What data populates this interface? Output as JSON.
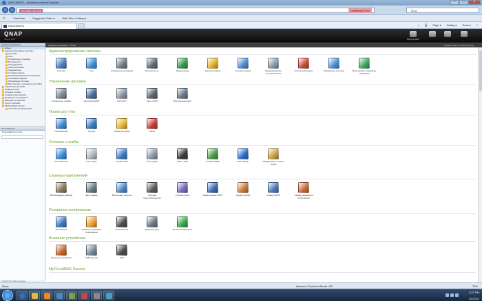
{
  "window": {
    "title": "NASC5B97D - Windows Internet Explorer"
  },
  "address": {
    "url": "192.168.100.155",
    "certificate": "Certificate Error"
  },
  "search": {
    "placeholder": "Bing"
  },
  "favorites": {
    "label": "Favorites",
    "items": [
      "Suggested Sites ▾",
      "Web Slice Gallery ▾"
    ]
  },
  "tab": {
    "label": "NASC5B97D"
  },
  "commands": [
    "Page ▾",
    "Safety ▾",
    "Tools ▾"
  ],
  "qnap": {
    "logo": "QNAP",
    "tagline": "Simply NAS",
    "header_icons": [
      "Вход на сайт",
      "",
      "",
      ""
    ]
  },
  "breadcrumb": {
    "left": "Администрирование › Обзор",
    "right": "Администратор: admin | Выход"
  },
  "sidebar": {
    "top_header": "Администрирование",
    "items": [
      {
        "label": "Обзор",
        "level": 0,
        "selected": true
      },
      {
        "label": "Администрирование системы",
        "level": 0
      },
      {
        "label": "Система",
        "level": 1
      },
      {
        "label": "Сеть",
        "level": 1
      },
      {
        "label": "Аппаратные установки",
        "level": 1
      },
      {
        "label": "Безопасность",
        "level": 1
      },
      {
        "label": "Оборудование",
        "level": 1
      },
      {
        "label": "Электропитание",
        "level": 1
      },
      {
        "label": "Уведомления",
        "level": 1
      },
      {
        "label": "Сетевая корзина",
        "level": 1
      },
      {
        "label": "Резервирование/восстановление",
        "level": 1
      },
      {
        "label": "Системный журнал",
        "level": 1
      },
      {
        "label": "Обновление системы",
        "level": 1
      },
      {
        "label": "Восстановить заводские настройки",
        "level": 1
      },
      {
        "label": "Управление дисками",
        "level": 0
      },
      {
        "label": "Права доступа",
        "level": 0
      },
      {
        "label": "Сетевые службы",
        "level": 0
      },
      {
        "label": "Серверы приложений",
        "level": 0
      },
      {
        "label": "Резервное копирование",
        "level": 0
      },
      {
        "label": "Внешние устройства",
        "level": 0
      },
      {
        "label": "Статус системы",
        "level": 0
      },
      {
        "label": "MyCloudNAS Service",
        "level": 0
      },
      {
        "label": "Системная информация",
        "level": 1
      }
    ],
    "bottom_header": "Пользователи",
    "bottom_label": "Пользователи в сети:"
  },
  "sections": [
    {
      "title": "Администрирование системы",
      "items": [
        {
          "label": "Система",
          "icon": "system-icon",
          "color": "#4a7fc6"
        },
        {
          "label": "Сеть",
          "icon": "globe-icon",
          "color": "#3f8fd8"
        },
        {
          "label": "Аппаратные установки",
          "icon": "hardware-icon",
          "color": "#6f7a86"
        },
        {
          "label": "Безопасность",
          "icon": "security-icon",
          "color": "#5d6b7c"
        },
        {
          "label": "Уведомления",
          "icon": "notification-icon",
          "color": "#3a9a4a"
        },
        {
          "label": "Электропитание",
          "icon": "power-icon",
          "color": "#e8b020"
        },
        {
          "label": "Сетевая корзина",
          "icon": "recycle-bin-icon",
          "color": "#4a8ad0"
        },
        {
          "label": "Резервирование/восстановление установок",
          "icon": "backup-restore-icon",
          "color": "#8a9aaa"
        },
        {
          "label": "Системный журнал",
          "icon": "system-log-icon",
          "color": "#c84a3a"
        },
        {
          "label": "Обновление системы",
          "icon": "system-update-icon",
          "color": "#4a8fd8"
        },
        {
          "label": "Восстановить заводские параметры",
          "icon": "factory-reset-icon",
          "color": "#3aa85a"
        }
      ]
    },
    {
      "title": "Управление дисками",
      "items": [
        {
          "label": "Управление томами",
          "icon": "volume-management-icon",
          "color": "#7a8898"
        },
        {
          "label": "Настройка RAID",
          "icon": "raid-icon",
          "color": "#4a6a9a"
        },
        {
          "label": "S.M.A.R.T.",
          "icon": "hdd-smart-icon",
          "color": "#8a96a4"
        },
        {
          "label": "Цель iSCSI",
          "icon": "iscsi-icon",
          "color": "#5a6470"
        },
        {
          "label": "Виртуальный диск",
          "icon": "virtual-disk-icon",
          "color": "#6a7888"
        }
      ]
    },
    {
      "title": "Права доступа",
      "items": [
        {
          "label": "Пользователи",
          "icon": "users-icon",
          "color": "#3f8ad0"
        },
        {
          "label": "Группы",
          "icon": "groups-icon",
          "color": "#3a7ac4"
        },
        {
          "label": "Общие ресурсы",
          "icon": "shared-folders-icon",
          "color": "#e8b430"
        },
        {
          "label": "Квота",
          "icon": "quota-icon",
          "color": "#c83a3a"
        }
      ]
    },
    {
      "title": "Сетевые службы",
      "items": [
        {
          "label": "Сеть Microsoft",
          "icon": "microsoft-network-icon",
          "color": "#3a8ad8"
        },
        {
          "label": "Сеть Apple",
          "icon": "apple-network-icon",
          "color": "#b0b8c0"
        },
        {
          "label": "Служба NFS",
          "icon": "nfs-icon",
          "color": "#3a7ac0"
        },
        {
          "label": "FTP-сервер",
          "icon": "ftp-icon",
          "color": "#8a98a8"
        },
        {
          "label": "Telnet / SSH",
          "icon": "telnet-ssh-icon",
          "color": "#3a3a3a"
        },
        {
          "label": "Служба SNMP",
          "icon": "snmp-icon",
          "color": "#4a9a4a"
        },
        {
          "label": "Веб-сервер",
          "icon": "web-server-icon",
          "color": "#2a6ac8"
        },
        {
          "label": "Обнаружение сетевых служб",
          "icon": "service-discovery-icon",
          "color": "#c8a040"
        }
      ]
    },
    {
      "title": "Серверы приложений",
      "items": [
        {
          "label": "Веб-менеджер файлов",
          "icon": "web-file-manager-icon",
          "color": "#8a7a5a"
        },
        {
          "label": "Фото-сервер",
          "icon": "photo-station-icon",
          "color": "#6a7a8a"
        },
        {
          "label": "Веб-сервер загрузок",
          "icon": "download-station-icon",
          "color": "#4a8ac8"
        },
        {
          "label": "Система видеонаблюдения",
          "icon": "surveillance-icon",
          "color": "#5a5a5a"
        },
        {
          "label": "Служба iTunes",
          "icon": "itunes-icon",
          "color": "#7a6ac0"
        },
        {
          "label": "Медиа-сервер UPnP",
          "icon": "upnp-media-icon",
          "color": "#3a6ab0"
        },
        {
          "label": "Сервер MySQL",
          "icon": "mysql-icon",
          "color": "#c87a3a"
        },
        {
          "label": "Сервер QPKG",
          "icon": "qpkg-icon",
          "color": "#4a7ab8"
        },
        {
          "label": "Сервер резервного копирования",
          "icon": "backup-server-icon",
          "color": "#c86a3a"
        }
      ]
    },
    {
      "title": "Резервное копирование",
      "items": [
        {
          "label": "Репликация",
          "icon": "replication-icon",
          "color": "#3a7ac8"
        },
        {
          "label": "Облачное резервное копирование",
          "icon": "cloud-backup-icon",
          "color": "#e8a030"
        },
        {
          "label": "Time Machine",
          "icon": "time-machine-icon",
          "color": "#4a4a4a"
        },
        {
          "label": "Внешний диск",
          "icon": "external-drive-icon",
          "color": "#6a7a8a"
        },
        {
          "label": "Кнопка копирования",
          "icon": "copy-button-icon",
          "color": "#3aa84a"
        }
      ]
    },
    {
      "title": "Внешние устройства",
      "items": [
        {
          "label": "Внешнее устройство",
          "icon": "external-device-icon",
          "color": "#c86a2a"
        },
        {
          "label": "USB-принтер",
          "icon": "usb-printer-icon",
          "color": "#7a8a9a"
        },
        {
          "label": "UPS",
          "icon": "ups-icon",
          "color": "#4a4a4a"
        }
      ]
    },
    {
      "title": "MyCloudNAS Service",
      "items": []
    }
  ],
  "page_copyright": "© QNAP. Все права защищены",
  "status": {
    "left": "Done",
    "mid": "Internet | Protected Mode: Off",
    "zoom": "75%"
  },
  "clock": {
    "time": "3:27 PM",
    "date": "1/2/2011"
  }
}
